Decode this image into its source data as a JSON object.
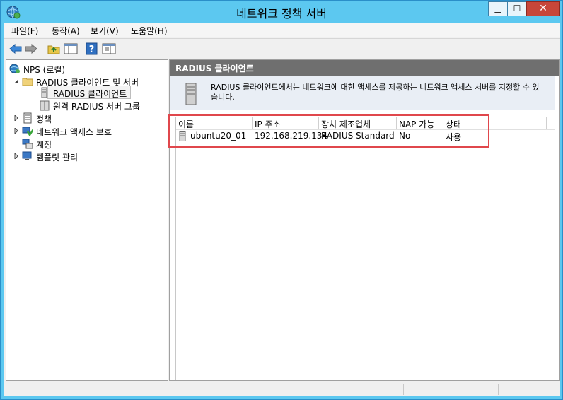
{
  "window": {
    "title": "네트워크 정책 서버"
  },
  "menu": [
    "파일(F)",
    "동작(A)",
    "보기(V)",
    "도움말(H)"
  ],
  "tree": {
    "root": "NPS (로컬)",
    "radius_group": "RADIUS 클라이언트 및 서버",
    "radius_clients": "RADIUS 클라이언트",
    "remote_groups": "원격 RADIUS 서버 그룹",
    "policies": "정책",
    "nap": "네트워크 액세스 보호",
    "accounting": "계정",
    "templates": "템플릿 관리"
  },
  "panel": {
    "header": "RADIUS 클라이언트",
    "description": "RADIUS 클라이언트에서는 네트워크에 대한 액세스를 제공하는 네트워크 액세스 서버를 지정할 수 있습니다."
  },
  "list": {
    "columns": [
      "이름",
      "IP 주소",
      "장치 제조업체",
      "NAP 가능",
      "상태"
    ],
    "rows": [
      {
        "name": "ubuntu20_01",
        "ip": "192.168.219.134",
        "vendor": "RADIUS Standard",
        "nap": "No",
        "status": "사용"
      }
    ]
  },
  "colors": {
    "titlebar": "#5cc8f0",
    "panel_header": "#6f6f6f",
    "highlight": "#e0474c",
    "close": "#c7463a"
  }
}
